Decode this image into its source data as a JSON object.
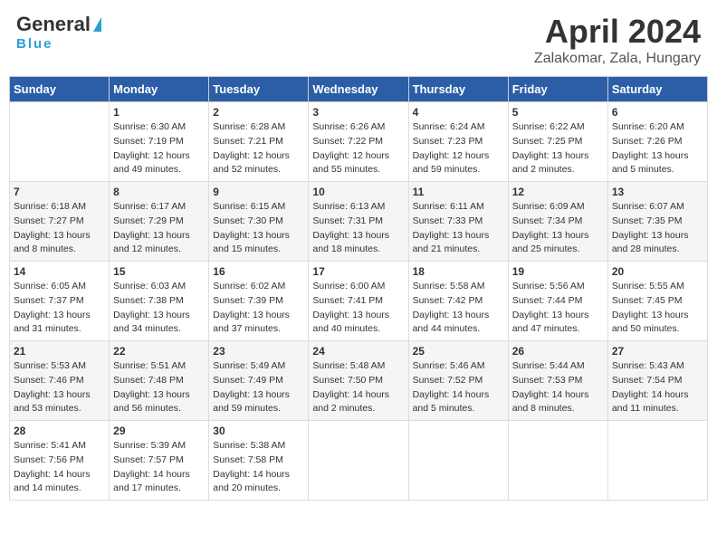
{
  "logo": {
    "general": "General",
    "blue": "Blue",
    "tagline": "Blue"
  },
  "header": {
    "title": "April 2024",
    "subtitle": "Zalakomar, Zala, Hungary"
  },
  "weekdays": [
    "Sunday",
    "Monday",
    "Tuesday",
    "Wednesday",
    "Thursday",
    "Friday",
    "Saturday"
  ],
  "weeks": [
    [
      {
        "day": "",
        "sunrise": "",
        "sunset": "",
        "daylight": ""
      },
      {
        "day": "1",
        "sunrise": "Sunrise: 6:30 AM",
        "sunset": "Sunset: 7:19 PM",
        "daylight": "Daylight: 12 hours and 49 minutes."
      },
      {
        "day": "2",
        "sunrise": "Sunrise: 6:28 AM",
        "sunset": "Sunset: 7:21 PM",
        "daylight": "Daylight: 12 hours and 52 minutes."
      },
      {
        "day": "3",
        "sunrise": "Sunrise: 6:26 AM",
        "sunset": "Sunset: 7:22 PM",
        "daylight": "Daylight: 12 hours and 55 minutes."
      },
      {
        "day": "4",
        "sunrise": "Sunrise: 6:24 AM",
        "sunset": "Sunset: 7:23 PM",
        "daylight": "Daylight: 12 hours and 59 minutes."
      },
      {
        "day": "5",
        "sunrise": "Sunrise: 6:22 AM",
        "sunset": "Sunset: 7:25 PM",
        "daylight": "Daylight: 13 hours and 2 minutes."
      },
      {
        "day": "6",
        "sunrise": "Sunrise: 6:20 AM",
        "sunset": "Sunset: 7:26 PM",
        "daylight": "Daylight: 13 hours and 5 minutes."
      }
    ],
    [
      {
        "day": "7",
        "sunrise": "Sunrise: 6:18 AM",
        "sunset": "Sunset: 7:27 PM",
        "daylight": "Daylight: 13 hours and 8 minutes."
      },
      {
        "day": "8",
        "sunrise": "Sunrise: 6:17 AM",
        "sunset": "Sunset: 7:29 PM",
        "daylight": "Daylight: 13 hours and 12 minutes."
      },
      {
        "day": "9",
        "sunrise": "Sunrise: 6:15 AM",
        "sunset": "Sunset: 7:30 PM",
        "daylight": "Daylight: 13 hours and 15 minutes."
      },
      {
        "day": "10",
        "sunrise": "Sunrise: 6:13 AM",
        "sunset": "Sunset: 7:31 PM",
        "daylight": "Daylight: 13 hours and 18 minutes."
      },
      {
        "day": "11",
        "sunrise": "Sunrise: 6:11 AM",
        "sunset": "Sunset: 7:33 PM",
        "daylight": "Daylight: 13 hours and 21 minutes."
      },
      {
        "day": "12",
        "sunrise": "Sunrise: 6:09 AM",
        "sunset": "Sunset: 7:34 PM",
        "daylight": "Daylight: 13 hours and 25 minutes."
      },
      {
        "day": "13",
        "sunrise": "Sunrise: 6:07 AM",
        "sunset": "Sunset: 7:35 PM",
        "daylight": "Daylight: 13 hours and 28 minutes."
      }
    ],
    [
      {
        "day": "14",
        "sunrise": "Sunrise: 6:05 AM",
        "sunset": "Sunset: 7:37 PM",
        "daylight": "Daylight: 13 hours and 31 minutes."
      },
      {
        "day": "15",
        "sunrise": "Sunrise: 6:03 AM",
        "sunset": "Sunset: 7:38 PM",
        "daylight": "Daylight: 13 hours and 34 minutes."
      },
      {
        "day": "16",
        "sunrise": "Sunrise: 6:02 AM",
        "sunset": "Sunset: 7:39 PM",
        "daylight": "Daylight: 13 hours and 37 minutes."
      },
      {
        "day": "17",
        "sunrise": "Sunrise: 6:00 AM",
        "sunset": "Sunset: 7:41 PM",
        "daylight": "Daylight: 13 hours and 40 minutes."
      },
      {
        "day": "18",
        "sunrise": "Sunrise: 5:58 AM",
        "sunset": "Sunset: 7:42 PM",
        "daylight": "Daylight: 13 hours and 44 minutes."
      },
      {
        "day": "19",
        "sunrise": "Sunrise: 5:56 AM",
        "sunset": "Sunset: 7:44 PM",
        "daylight": "Daylight: 13 hours and 47 minutes."
      },
      {
        "day": "20",
        "sunrise": "Sunrise: 5:55 AM",
        "sunset": "Sunset: 7:45 PM",
        "daylight": "Daylight: 13 hours and 50 minutes."
      }
    ],
    [
      {
        "day": "21",
        "sunrise": "Sunrise: 5:53 AM",
        "sunset": "Sunset: 7:46 PM",
        "daylight": "Daylight: 13 hours and 53 minutes."
      },
      {
        "day": "22",
        "sunrise": "Sunrise: 5:51 AM",
        "sunset": "Sunset: 7:48 PM",
        "daylight": "Daylight: 13 hours and 56 minutes."
      },
      {
        "day": "23",
        "sunrise": "Sunrise: 5:49 AM",
        "sunset": "Sunset: 7:49 PM",
        "daylight": "Daylight: 13 hours and 59 minutes."
      },
      {
        "day": "24",
        "sunrise": "Sunrise: 5:48 AM",
        "sunset": "Sunset: 7:50 PM",
        "daylight": "Daylight: 14 hours and 2 minutes."
      },
      {
        "day": "25",
        "sunrise": "Sunrise: 5:46 AM",
        "sunset": "Sunset: 7:52 PM",
        "daylight": "Daylight: 14 hours and 5 minutes."
      },
      {
        "day": "26",
        "sunrise": "Sunrise: 5:44 AM",
        "sunset": "Sunset: 7:53 PM",
        "daylight": "Daylight: 14 hours and 8 minutes."
      },
      {
        "day": "27",
        "sunrise": "Sunrise: 5:43 AM",
        "sunset": "Sunset: 7:54 PM",
        "daylight": "Daylight: 14 hours and 11 minutes."
      }
    ],
    [
      {
        "day": "28",
        "sunrise": "Sunrise: 5:41 AM",
        "sunset": "Sunset: 7:56 PM",
        "daylight": "Daylight: 14 hours and 14 minutes."
      },
      {
        "day": "29",
        "sunrise": "Sunrise: 5:39 AM",
        "sunset": "Sunset: 7:57 PM",
        "daylight": "Daylight: 14 hours and 17 minutes."
      },
      {
        "day": "30",
        "sunrise": "Sunrise: 5:38 AM",
        "sunset": "Sunset: 7:58 PM",
        "daylight": "Daylight: 14 hours and 20 minutes."
      },
      {
        "day": "",
        "sunrise": "",
        "sunset": "",
        "daylight": ""
      },
      {
        "day": "",
        "sunrise": "",
        "sunset": "",
        "daylight": ""
      },
      {
        "day": "",
        "sunrise": "",
        "sunset": "",
        "daylight": ""
      },
      {
        "day": "",
        "sunrise": "",
        "sunset": "",
        "daylight": ""
      }
    ]
  ]
}
